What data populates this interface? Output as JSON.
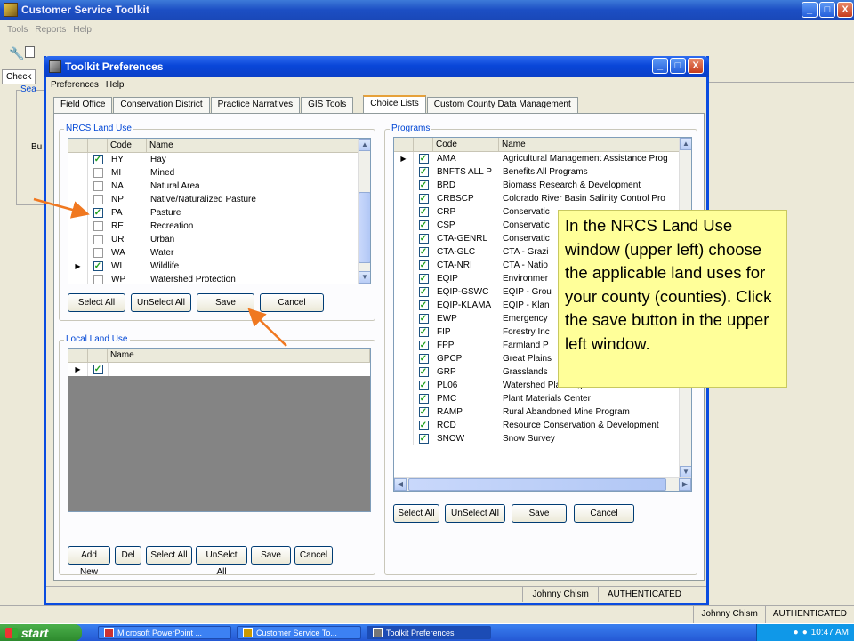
{
  "main_window": {
    "title": "Customer Service Toolkit",
    "menu": [
      "Tools",
      "Reports",
      "Help"
    ],
    "bg_tab": "Check",
    "bg_group": "Sea",
    "bg_label": "Bu",
    "status_user": "Johnny Chism",
    "status_auth": "AUTHENTICATED",
    "controls": {
      "minimize": "_",
      "maximize": "□",
      "close": "X"
    }
  },
  "dialog": {
    "title": "Toolkit Preferences",
    "menu": [
      "Preferences",
      "Help"
    ],
    "controls": {
      "minimize": "_",
      "maximize": "□",
      "close": "X"
    },
    "tabs": [
      "Field Office",
      "Conservation District",
      "Practice Narratives",
      "GIS Tools",
      "Choice Lists",
      "Custom County Data Management"
    ],
    "selected_tab": "Choice Lists",
    "status_user": "Johnny Chism",
    "status_auth": "AUTHENTICATED"
  },
  "nrcs_land_use": {
    "label": "NRCS Land Use",
    "headers": {
      "code": "Code",
      "name": "Name"
    },
    "rows": [
      {
        "checked": true,
        "code": "HY",
        "name": "Hay",
        "current": false
      },
      {
        "checked": false,
        "code": "MI",
        "name": "Mined",
        "current": false
      },
      {
        "checked": false,
        "code": "NA",
        "name": "Natural Area",
        "current": false
      },
      {
        "checked": false,
        "code": "NP",
        "name": "Native/Naturalized Pasture",
        "current": false
      },
      {
        "checked": true,
        "code": "PA",
        "name": "Pasture",
        "current": false
      },
      {
        "checked": false,
        "code": "RE",
        "name": "Recreation",
        "current": false
      },
      {
        "checked": false,
        "code": "UR",
        "name": "Urban",
        "current": false
      },
      {
        "checked": false,
        "code": "WA",
        "name": "Water",
        "current": false
      },
      {
        "checked": true,
        "code": "WL",
        "name": "Wildlife",
        "current": true
      },
      {
        "checked": false,
        "code": "WP",
        "name": "Watershed Protection",
        "current": false
      }
    ],
    "buttons": {
      "select_all": "Select All",
      "unselect_all": "UnSelect All",
      "save": "Save",
      "cancel": "Cancel"
    }
  },
  "local_land_use": {
    "label": "Local Land Use",
    "headers": {
      "name": "Name"
    },
    "buttons": {
      "add_new": "Add New",
      "del": "Del",
      "select_all": "Select All",
      "unselect_all": "UnSelct All",
      "save": "Save",
      "cancel": "Cancel"
    }
  },
  "programs": {
    "label": "Programs",
    "headers": {
      "code": "Code",
      "name": "Name"
    },
    "rows": [
      {
        "code": "AMA",
        "name": "Agricultural Management Assistance Prog"
      },
      {
        "code": "BNFTS ALL P",
        "name": "Benefits All Programs"
      },
      {
        "code": "BRD",
        "name": "Biomass Research & Development"
      },
      {
        "code": "CRBSCP",
        "name": "Colorado River Basin Salinity Control Pro"
      },
      {
        "code": "CRP",
        "name": "Conservatic"
      },
      {
        "code": "CSP",
        "name": "Conservatic"
      },
      {
        "code": "CTA-GENRL",
        "name": "Conservatic"
      },
      {
        "code": "CTA-GLC",
        "name": "CTA - Grazi"
      },
      {
        "code": "CTA-NRI",
        "name": "CTA - Natio"
      },
      {
        "code": "EQIP",
        "name": "Environmer"
      },
      {
        "code": "EQIP-GSWC",
        "name": "EQIP - Grou"
      },
      {
        "code": "EQIP-KLAMA",
        "name": "EQIP - Klan"
      },
      {
        "code": "EWP",
        "name": "Emergency"
      },
      {
        "code": "FIP",
        "name": "Forestry Inc"
      },
      {
        "code": "FPP",
        "name": "Farmland P"
      },
      {
        "code": "GPCP",
        "name": "Great Plains"
      },
      {
        "code": "GRP",
        "name": "Grasslands"
      },
      {
        "code": "PL06",
        "name": "Watershed Planning"
      },
      {
        "code": "PMC",
        "name": "Plant Materials Center"
      },
      {
        "code": "RAMP",
        "name": "Rural Abandoned Mine Program"
      },
      {
        "code": "RCD",
        "name": "Resource Conservation & Development"
      },
      {
        "code": "SNOW",
        "name": "Snow Survey"
      }
    ],
    "buttons": {
      "select_all": "Select All",
      "unselect_all": "UnSelect All",
      "save": "Save",
      "cancel": "Cancel"
    }
  },
  "callout_text": "In the NRCS Land Use window (upper left) choose the applicable land uses for your county (counties). Click the save button in the upper left window.",
  "taskbar": {
    "start": "start",
    "tasks": [
      "Microsoft PowerPoint ...",
      "Customer Service To...",
      "Toolkit Preferences"
    ],
    "clock": "10:47 AM"
  },
  "colors": {
    "callout_bg": "#ffff99",
    "arrow": "#f07820",
    "titlebar": "#0a46d8",
    "check": "#21a121"
  }
}
